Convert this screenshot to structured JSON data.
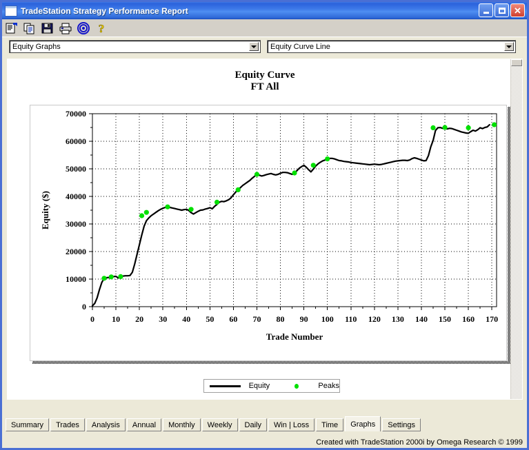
{
  "window": {
    "title": "TradeStation Strategy Performance Report",
    "icon": "window-icon",
    "buttons": {
      "minimize": "_",
      "maximize": "□",
      "close": "✕"
    }
  },
  "toolbar": {
    "items": [
      {
        "name": "report-properties-icon",
        "label": "Report Properties"
      },
      {
        "name": "copy-icon",
        "label": "Copy"
      },
      {
        "name": "save-icon",
        "label": "Save"
      },
      {
        "name": "print-icon",
        "label": "Print"
      },
      {
        "name": "target-icon",
        "label": "Omega Research"
      },
      {
        "name": "help-icon",
        "label": "Help"
      }
    ]
  },
  "selectors": {
    "report_type": {
      "value": "Equity Graphs",
      "options": [
        "Equity Graphs"
      ]
    },
    "graph_type": {
      "value": "Equity Curve Line",
      "options": [
        "Equity Curve Line"
      ]
    }
  },
  "chart_data": {
    "type": "line",
    "title": "Equity Curve",
    "subtitle": "FT All",
    "xlabel": "Trade Number",
    "ylabel": "Equity ($)",
    "xlim": [
      0,
      172
    ],
    "ylim": [
      0,
      70000
    ],
    "xticks": [
      0,
      10,
      20,
      30,
      40,
      50,
      60,
      70,
      80,
      90,
      100,
      110,
      120,
      130,
      140,
      150,
      160,
      170
    ],
    "yticks": [
      0,
      10000,
      20000,
      30000,
      40000,
      50000,
      60000,
      70000
    ],
    "yminorticks": [
      5000,
      15000,
      25000,
      35000,
      45000,
      55000,
      65000
    ],
    "grid": true,
    "legend": [
      {
        "label": "Equity",
        "marker": "line",
        "color": "#000000"
      },
      {
        "label": "Peaks",
        "marker": "dot",
        "color": "#00e000"
      }
    ],
    "series": [
      {
        "name": "Equity",
        "color": "#000000",
        "x": [
          0,
          1,
          2,
          3,
          4,
          5,
          6,
          7,
          8,
          9,
          10,
          11,
          12,
          13,
          14,
          15,
          16,
          17,
          18,
          19,
          20,
          21,
          22,
          23,
          24,
          25,
          26,
          27,
          28,
          29,
          30,
          31,
          32,
          33,
          34,
          35,
          36,
          37,
          38,
          39,
          40,
          41,
          42,
          43,
          44,
          45,
          46,
          47,
          48,
          49,
          50,
          51,
          52,
          53,
          54,
          55,
          56,
          57,
          58,
          59,
          60,
          61,
          62,
          63,
          64,
          65,
          66,
          67,
          68,
          69,
          70,
          71,
          72,
          73,
          74,
          75,
          76,
          77,
          78,
          79,
          80,
          81,
          82,
          83,
          84,
          85,
          86,
          87,
          88,
          89,
          90,
          91,
          92,
          93,
          94,
          95,
          96,
          97,
          98,
          99,
          100,
          101,
          102,
          103,
          104,
          105,
          106,
          107,
          108,
          109,
          110,
          111,
          112,
          113,
          114,
          115,
          116,
          117,
          118,
          119,
          120,
          121,
          122,
          123,
          124,
          125,
          126,
          127,
          128,
          129,
          130,
          131,
          132,
          133,
          134,
          135,
          136,
          137,
          138,
          139,
          140,
          141,
          142,
          143,
          144,
          145,
          146,
          147,
          148,
          149,
          150,
          151,
          152,
          153,
          154,
          155,
          156,
          157,
          158,
          159,
          160,
          161,
          162,
          163,
          164,
          165,
          166,
          167,
          168,
          169,
          170,
          171
        ],
        "y": [
          300,
          1200,
          3200,
          6200,
          8800,
          10300,
          10500,
          10600,
          10800,
          10900,
          11000,
          10400,
          10900,
          11100,
          11200,
          11200,
          11300,
          12500,
          15500,
          19000,
          22500,
          26000,
          29200,
          31200,
          32200,
          33000,
          33600,
          34200,
          34800,
          35300,
          35700,
          36000,
          36200,
          36000,
          35800,
          35600,
          35400,
          35200,
          35000,
          35200,
          35300,
          34900,
          34100,
          33600,
          34100,
          34600,
          35000,
          35100,
          35400,
          35600,
          35900,
          35500,
          36400,
          37100,
          37900,
          38200,
          38100,
          38400,
          38800,
          39500,
          40600,
          41600,
          42400,
          43200,
          44000,
          44600,
          45200,
          45800,
          46600,
          47300,
          48000,
          47700,
          47400,
          47600,
          47900,
          48100,
          48300,
          48000,
          47800,
          48000,
          48400,
          48700,
          48700,
          48600,
          48300,
          48000,
          48500,
          49300,
          50200,
          50800,
          51300,
          50600,
          49700,
          48900,
          49900,
          51000,
          51800,
          52400,
          52900,
          53200,
          53600,
          53800,
          53800,
          53600,
          53300,
          53000,
          52900,
          52700,
          52600,
          52500,
          52300,
          52200,
          52100,
          52000,
          51900,
          51800,
          51700,
          51600,
          51500,
          51600,
          51700,
          51600,
          51500,
          51600,
          51800,
          52000,
          52200,
          52400,
          52600,
          52800,
          52900,
          53000,
          53100,
          53100,
          53000,
          53200,
          53700,
          54000,
          53800,
          53500,
          53200,
          52900,
          53000,
          54800,
          58000,
          60300,
          63900,
          64900,
          65000,
          64700,
          64600,
          64500,
          64700,
          64600,
          64300,
          64000,
          63700,
          63400,
          63200,
          63000,
          62900,
          63500,
          64000,
          63700,
          64200,
          64900,
          64600,
          65000,
          65200,
          66000
        ]
      }
    ],
    "peaks": {
      "name": "Peaks",
      "color": "#00e000",
      "x": [
        5,
        8,
        12,
        21,
        23,
        32,
        42,
        53,
        62,
        70,
        86,
        94,
        100,
        145,
        150,
        160,
        171
      ],
      "y": [
        10300,
        10800,
        10900,
        33000,
        34200,
        36200,
        35300,
        37900,
        42400,
        48000,
        48500,
        51300,
        53600,
        64900,
        65000,
        64900,
        66000
      ]
    }
  },
  "tabs": [
    {
      "label": "Summary",
      "active": false
    },
    {
      "label": "Trades",
      "active": false
    },
    {
      "label": "Analysis",
      "active": false
    },
    {
      "label": "Annual",
      "active": false
    },
    {
      "label": "Monthly",
      "active": false
    },
    {
      "label": "Weekly",
      "active": false
    },
    {
      "label": "Daily",
      "active": false
    },
    {
      "label": "Win | Loss",
      "active": false
    },
    {
      "label": "Time",
      "active": false
    },
    {
      "label": "Graphs",
      "active": true
    },
    {
      "label": "Settings",
      "active": false
    }
  ],
  "footer": {
    "text": "Created with TradeStation 2000i by Omega Research © 1999"
  }
}
